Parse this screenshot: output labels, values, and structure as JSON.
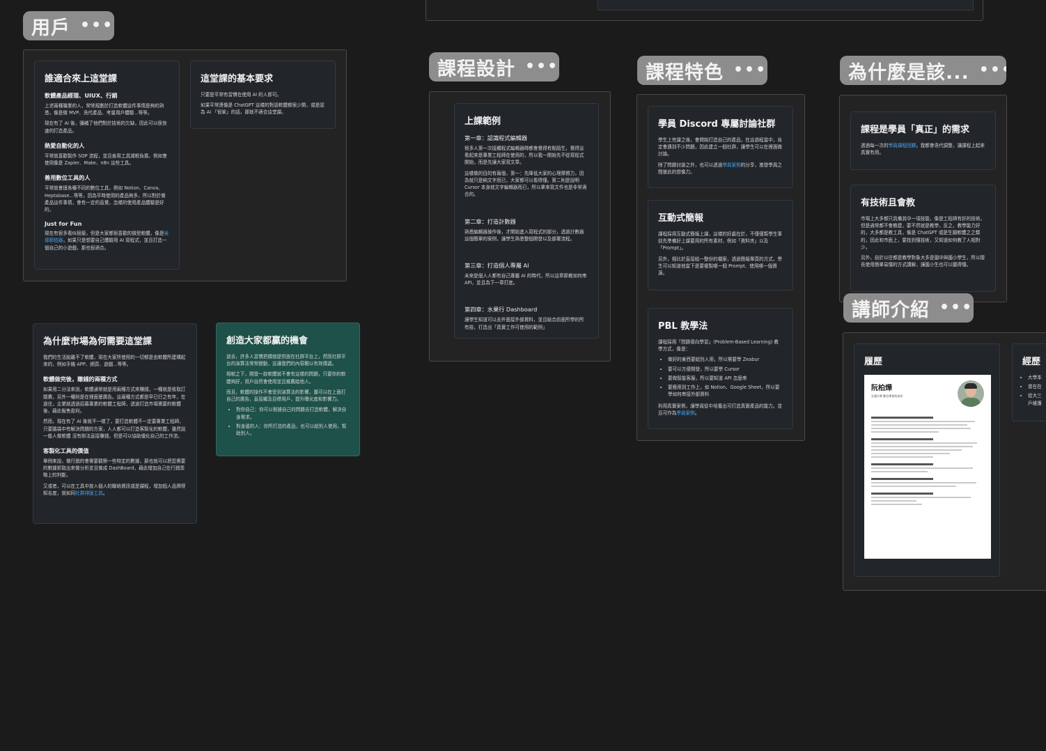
{
  "sections": {
    "users": {
      "title": "用戶",
      "cards": {
        "who": {
          "title": "誰適合來上這堂課",
          "h1": "軟體產品經理、UIUX、行銷",
          "p1": "上述兩種職業的人，常常規劃於打造軟體這件事情是夠的熟悉，像是做 MVP、迭代產品、考量用戶體驗...等等。",
          "p2": "現在有了 AI 後，彌補了他們對於技術的欠缺，因此可以很快速的打造產品。",
          "h2": "熱愛自動化的人",
          "p3": "平常就喜歡製作 SOP 流程，並且善用工具減輕負擔，例如會使用像是 Zapier、Make、n8n 這些工具。",
          "h3": "善用數位工具的人",
          "p4": "平常就會摸各種不同的數位工具，例如 Notion、Canva、Heptabase...等等，因為平時使用的產品夠多，所以對於做產品這件事情，會有一定的直覺，怎樣的使用產品體驗是好的。",
          "h4": "Just for Fun",
          "p5_pre": "現在有很多看似很廢，但是大家都很喜歡的微型軟體，像是",
          "p5_link": "吳導節拍器",
          "p5_post": "，如果只是想要自己體驗用 AI 寫程式，並且打造一個自己的小遊戲，那也很適合。"
        },
        "req": {
          "title": "這堂課的基本要求",
          "p1": "只要是平常有習慣在使用 AI 的人即可。",
          "p2": "如果平常連像是 ChatGPT 這樣的對話軟體都很少開，或是認為 AI 「很笨」的話，那就不適合這堂課。"
        }
      }
    },
    "market": {
      "title": "為什麼市場為何需要這堂課",
      "p1": "我們的生活脫離不了軟體，現在大家所使用的一切都是由軟體所建構起來的，例如手機 APP、網頁、遊戲...等等。",
      "h1": "軟體做完後，賺錢的兩種方式",
      "p2": "如果用二分法來說，軟體通常就是用兩種方式來賺錢，一種就是收取訂閱費，另外一種則是在裡面塞廣告。這兩種方式都是早已行之有年，在過往，企業就透過招募專業的軟體工程師，透過打造市場需要的軟體後，藉此販售盈利。",
      "p3": "然而，現在有了 AI 後就不一樣了，要打造軟體不一定要專業工程師，只要腦袋中有解決問題的方案，人人都可以打造客製化的軟體，雖然說一般人做軟體 沒有辦法直接賺錢，但是可以協助優化自己的工作流。",
      "h2": "客製化工具的價值",
      "p4": "舉例來說，做行銷的會需要觀察一些特定的數據，那也就可以把您需要的數據抓取出來做分析並且做成 DashBoard，藉此增加自己在行銷策略上的判斷。",
      "p5_pre": "又或者，可以在工具中放入個人的聯絡資訊或是課程，增加個人品牌得知名度，就如同",
      "p5_link": "社群排版工具",
      "p5_post": "。"
    },
    "winwin": {
      "title": "創造大家都贏的機會",
      "p1": "過去，許多人習慣把價值提供放在社群平台上，然而社群平台的演算法常常變動，這讓我們的內容難以有效傳遞。",
      "p2": "相較之下，開發一款軟體就不會有這樣的問題，只要你的軟體夠好，用戶自然會使用並且推薦給他人。",
      "p3": "而且，軟體的操作不會受到演算法的影響，還可以在上面打自己的廣告，直接觸及目標用戶，提升曝光度和影響力。",
      "b1": "對你自己：你可以根據自己的問題去打造軟體，解決自身需求。",
      "b2": "對身邊的人：你所打造的產品，也可以給別人使用，幫助別人。"
    },
    "design": {
      "title": "課程設計",
      "card": {
        "title": "上課範例",
        "ch1": "第一章：認識程式編輯器",
        "ch1_p1": "很多人第一次接觸程式編輯器時都會覺得有點陌生，覺得這看起來是專業工程師在使用的，所以我一開始先不從寫程式開始，而是先讓大家寫文章。",
        "ch1_p2": "這樣做的目的有兩個，第一：先降低大家的心理摩擦力，因為就只是純文字而已，大家都可以看得懂。第二則是說明 Cursor 本身就文字編輯器而已，所以拿來寫文件也是非常適合的。",
        "ch2": "第二章：打造計數器",
        "ch2_p": "熟悉編輯器操作後，才開始進入寫程式的部分，透過計數器這個簡單的案例，讓學生熟悉整個開發以及部署流程。",
        "ch3": "第三章：打造個人專屬 AI",
        "ch3_p": "未來是個人人都有自己專屬 AI 的時代，所以這章節教如何串 API，並且為下一章打底。",
        "ch4": "第四章：水果行 Dashboard",
        "ch4_p": "讓學生知道可以去外面接外部資料，並且結合前面所學的所有技，打造出「真實工作可使用的範例」"
      }
    },
    "features": {
      "title": "課程特色",
      "discord": {
        "title": "學員 Discord 專屬討論社群",
        "p1": "學生上完課之後，會開始打造自己的產品，在這過程當中，肯定會遇到不少問題，因此建立一個社群，讓學生可以在裡面做討論。",
        "p2_pre": "除了問題討論之外，也可以透過",
        "p2_link": "學員案例",
        "p2_post": "的分享，激發學員之間彼此的想像力。"
      },
      "slides": {
        "title": "互動式簡報",
        "p1": "課程採用互動式簡報上課，這樣的好處在於，不僅僅幫學生事前先準備好上課要用的所有素材，例如「資料夾」以及「Prompt」。",
        "p2": "另外，相比於直接給一整份的檔案，透過簡報單頁的方式，學生可以知道他當下是要複製哪一個 Prompt、使用哪一個資源。"
      },
      "pbl": {
        "title": "PBL 教學法",
        "p1": "課程採用「問題導向學習」(Problem-Based Learning) 教學方式，像是：",
        "b1": "做好的東西要給別人用，所以需要學 Zeabur",
        "b2": "要可以方便開發，所以要學 Cursor",
        "b3": "要做智能客服，所以要知道 API 怎麼串",
        "b4": "要應用到工作上，如 Notion、Google Sheet，所以要學如何串接外部資料",
        "p2": "利用真實案例，讓學員從中培養出可打造真實產品的能力。並且可作為",
        "p2_link": "學員案例",
        "p2_post": "。"
      }
    },
    "why": {
      "title": "為什麼是該...",
      "need": {
        "title": "課程是學員「真正」的需求",
        "p1_pre": "透過每一次的",
        "p1_link": "學員課程回饋",
        "p1_post": "，我都會迭代調整，讓課程上起來真實有用。"
      },
      "teach": {
        "title": "有技術且會教",
        "p1": "市場上大多都只具備其中一項技能，像是工程師有好的技術，但是通常都不會教建，要不然就是教學，反之，教學能力好的，大多都是教工具，像是 ChatGPT 或是生圖軟體之之類的，因此和市面上，要找到懂技術，又知道如何教了人相對少。",
        "p2": "另外，自於以往都是教學對象大多是國中與國小學生，所以擅長使用簡單易懂的方式講解，讓國小生也可以聽得懂。"
      }
    },
    "instructor": {
      "title": "講師介紹",
      "resume_title": "履歷",
      "resume_name": "阮柏燁",
      "resume_sub": "交通大學 數位學習科技所",
      "exp_title": "經歷",
      "exp_b1": "大學本",
      "exp_b2": "曾在在",
      "exp_b3": "從大三",
      "exp_b3b": "戶維護"
    }
  },
  "colors": {
    "background": "#1b1b1b",
    "pill": "#8d8d8d",
    "card": "#22262a",
    "teal": "#1e5149",
    "link": "#4ea3f1"
  }
}
